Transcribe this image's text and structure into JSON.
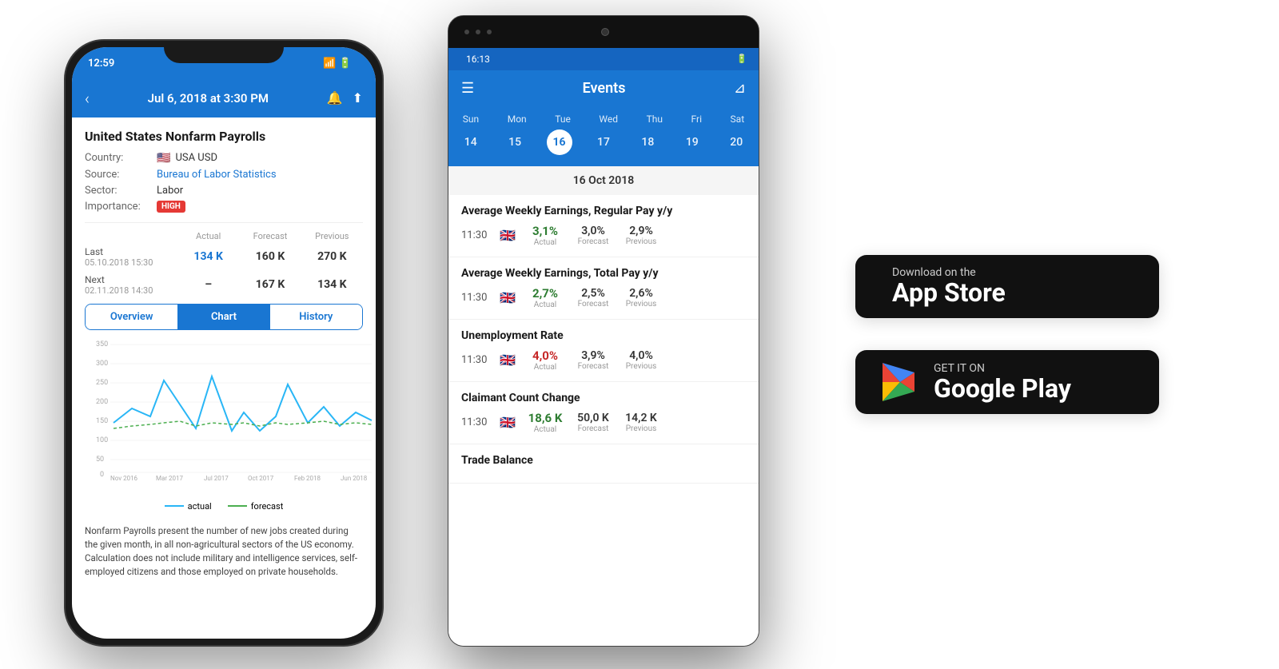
{
  "iphone": {
    "status_time": "12:59",
    "nav_date": "Jul 6, 2018 at 3:30 PM",
    "event_title": "United States Nonfarm Payrolls",
    "country_label": "Country:",
    "country_value": "USA USD",
    "source_label": "Source:",
    "source_value": "Bureau of Labor Statistics",
    "sector_label": "Sector:",
    "sector_value": "Labor",
    "importance_label": "Importance:",
    "importance_value": "HIGH",
    "last_label": "Last",
    "last_date": "05.10.2018 15:30",
    "actual_header": "Actual",
    "forecast_header": "Forecast",
    "previous_header": "Previous",
    "last_actual": "134 K",
    "last_forecast": "160 K",
    "last_previous": "270 K",
    "next_label": "Next",
    "next_date": "02.11.2018 14:30",
    "next_actual": "–",
    "next_forecast": "167 K",
    "next_previous": "134 K",
    "tab_overview": "Overview",
    "tab_chart": "Chart",
    "tab_history": "History",
    "chart_x_labels": [
      "Nov 2016",
      "Mar 2017",
      "Jul 2017",
      "Oct 2017",
      "Feb 2018",
      "Jun 2018"
    ],
    "chart_y_labels": [
      "350",
      "300",
      "250",
      "200",
      "150",
      "100",
      "50",
      "0"
    ],
    "legend_actual": "actual",
    "legend_forecast": "forecast",
    "description": "Nonfarm Payrolls present the number of new jobs created during the given month, in all non-agricultural sectors of the US economy. Calculation does not include military and intelligence services, self-employed citizens and those employed on private households."
  },
  "android": {
    "status_time": "16:13",
    "nav_title": "Events",
    "week_days": [
      "Sun",
      "Mon",
      "Tue",
      "Wed",
      "Thu",
      "Fri",
      "Sat"
    ],
    "week_dates": [
      "14",
      "15",
      "16",
      "17",
      "18",
      "19",
      "20"
    ],
    "selected_date_index": 2,
    "date_header": "16 Oct 2018",
    "events": [
      {
        "title": "Average Weekly Earnings, Regular Pay y/y",
        "time": "11:30",
        "actual": "3,1%",
        "actual_color": "green",
        "forecast": "3,0%",
        "previous": "2,9%"
      },
      {
        "title": "Average Weekly Earnings, Total Pay y/y",
        "time": "11:30",
        "actual": "2,7%",
        "actual_color": "green",
        "forecast": "2,5%",
        "previous": "2,6%"
      },
      {
        "title": "Unemployment Rate",
        "time": "11:30",
        "actual": "4,0%",
        "actual_color": "red",
        "forecast": "3,9%",
        "previous": "4,0%"
      },
      {
        "title": "Claimant Count Change",
        "time": "11:30",
        "actual": "18,6 K",
        "actual_color": "green",
        "forecast": "50,0 K",
        "previous": "14,2 K"
      },
      {
        "title": "Trade Balance",
        "time": "",
        "actual": "",
        "actual_color": "green",
        "forecast": "",
        "previous": ""
      }
    ]
  },
  "app_store": {
    "small_text": "Download on the",
    "large_text": "App Store"
  },
  "google_play": {
    "small_text": "GET IT ON",
    "large_text": "Google Play"
  }
}
